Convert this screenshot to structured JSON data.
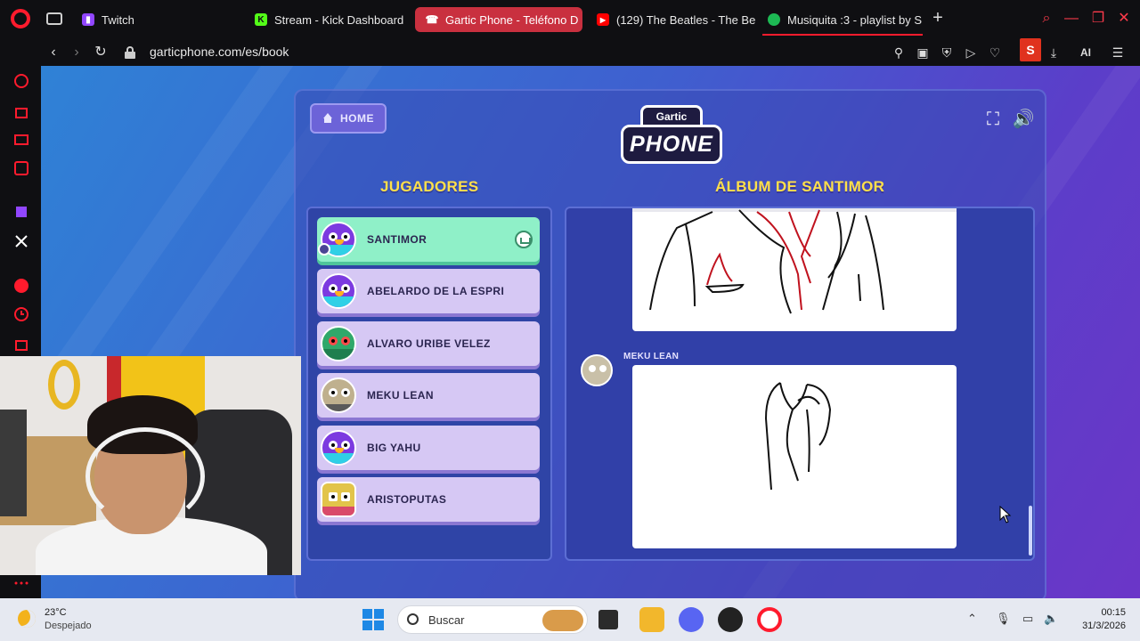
{
  "browser": {
    "tabs": [
      {
        "label": "Twitch",
        "icon": "twitch-icon",
        "color": "#9146ff"
      },
      {
        "label": "Stream - Kick Dashboard",
        "icon": "kick-icon",
        "color": "#53fc18"
      },
      {
        "label": "Gartic Phone - Teléfono D",
        "icon": "phone-icon",
        "color": "#ffffff"
      },
      {
        "label": "(129) The Beatles - The Be",
        "icon": "youtube-icon",
        "color": "#ff0000"
      },
      {
        "label": "Musiquita :3 - playlist by S",
        "icon": "spotify-icon",
        "color": "#1db954"
      }
    ],
    "url": "garticphone.com/es/book",
    "accent": "#ff1b2d",
    "toolbar_extra": "AI",
    "profile_badge": "S"
  },
  "game": {
    "home_label": "HOME",
    "logo_top": "Gartic",
    "logo_bottom": "PHONE",
    "players_title": "JUGADORES",
    "album_title": "ÁLBUM DE SANTIMOR",
    "players": [
      {
        "name": "SANTIMOR",
        "avatar": "bird-avatar",
        "host": true
      },
      {
        "name": "ABELARDO DE LA ESPRI",
        "avatar": "bird-avatar"
      },
      {
        "name": "ALVARO URIBE VELEZ",
        "avatar": "green-monster-avatar"
      },
      {
        "name": "MEKU LEAN",
        "avatar": "cat-avatar"
      },
      {
        "name": "BIG YAHU",
        "avatar": "bird-avatar"
      },
      {
        "name": "ARISTOPUTAS",
        "avatar": "robot-avatar"
      }
    ],
    "album": {
      "entries": [
        {
          "type": "drawing",
          "subject": "suit jacket sketch"
        },
        {
          "type": "drawing",
          "author": "MEKU LEAN",
          "subject": "tie sketch"
        }
      ]
    }
  },
  "taskbar": {
    "temperature": "23°C",
    "weather": "Despejado",
    "search_placeholder": "Buscar",
    "time": "00:15",
    "date": "31/3/2026"
  }
}
